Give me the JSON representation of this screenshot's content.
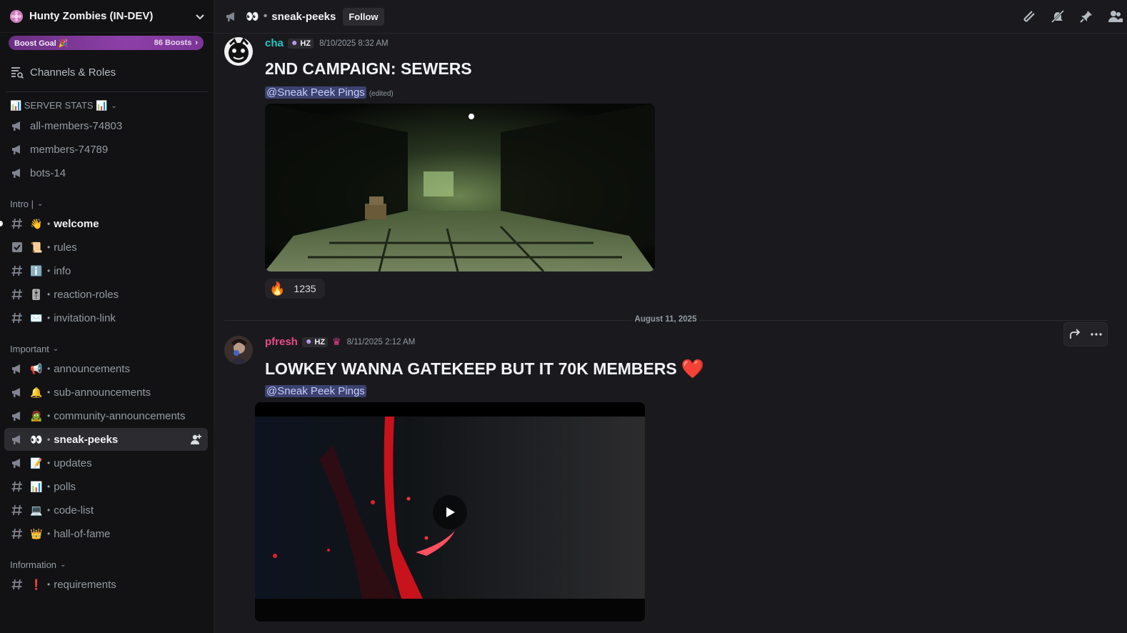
{
  "server": {
    "name": "Hunty Zombies (IN-DEV)",
    "boost_goal_label": "Boost Goal 🎉",
    "boost_count": "86 Boosts"
  },
  "sidebar": {
    "channels_roles": "Channels & Roles",
    "categories": [
      {
        "label": "📊 SERVER STATS 📊",
        "channels": [
          {
            "name": "all-members-74803",
            "icon": "announcement-icon"
          },
          {
            "name": "members-74789",
            "icon": "announcement-icon"
          },
          {
            "name": "bots-14",
            "icon": "announcement-icon"
          }
        ]
      },
      {
        "label": "Intro |",
        "channels": [
          {
            "emoji": "👋",
            "name": "welcome",
            "icon": "hash-icon",
            "unread": true
          },
          {
            "emoji": "📜",
            "name": "rules",
            "icon": "rules-icon"
          },
          {
            "emoji": "ℹ️",
            "name": "info",
            "icon": "hash-icon"
          },
          {
            "emoji": "🎚️",
            "name": "reaction-roles",
            "icon": "hash-icon"
          },
          {
            "emoji": "✉️",
            "name": "invitation-link",
            "icon": "hash-icon"
          }
        ]
      },
      {
        "label": "Important",
        "channels": [
          {
            "emoji": "📢",
            "name": "announcements",
            "icon": "announcement-icon"
          },
          {
            "emoji": "🔔",
            "name": "sub-announcements",
            "icon": "announcement-icon"
          },
          {
            "emoji": "🧟",
            "name": "community-announcements",
            "icon": "announcement-icon"
          },
          {
            "emoji": "👀",
            "name": "sneak-peeks",
            "icon": "announcement-icon",
            "active": true
          },
          {
            "emoji": "📝",
            "name": "updates",
            "icon": "announcement-icon"
          },
          {
            "emoji": "📊",
            "name": "polls",
            "icon": "hash-icon"
          },
          {
            "emoji": "💻",
            "name": "code-list",
            "icon": "hash-icon"
          },
          {
            "emoji": "👑",
            "name": "hall-of-fame",
            "icon": "hash-icon"
          }
        ]
      },
      {
        "label": "Information",
        "channels": [
          {
            "emoji": "❗",
            "name": "requirements",
            "icon": "hash-icon"
          }
        ]
      }
    ]
  },
  "header": {
    "emoji": "👀",
    "channel_name": "sneak-peeks",
    "follow_label": "Follow"
  },
  "messages": [
    {
      "author": "cha",
      "author_color": "#1fc7c2",
      "tag": "HZ",
      "timestamp": "8/10/2025 8:32 AM",
      "title": "2ND CAMPAIGN: SEWERS",
      "mention": "@Sneak Peek Pings",
      "edited": "(edited)",
      "reaction": {
        "emoji": "🔥",
        "count": "1235"
      }
    },
    {
      "author": "pfresh",
      "author_color": "#e94b8a",
      "tag": "HZ",
      "timestamp": "8/11/2025 2:12 AM",
      "title": "LOWKEY WANNA GATEKEEP BUT IT 70K MEMBERS",
      "heart": "❤️",
      "mention": "@Sneak Peek Pings"
    }
  ],
  "date_divider": "August 11, 2025",
  "colors": {
    "accent_mention_bg": "#3c4270",
    "boost_purple": "#8d3fa8"
  }
}
